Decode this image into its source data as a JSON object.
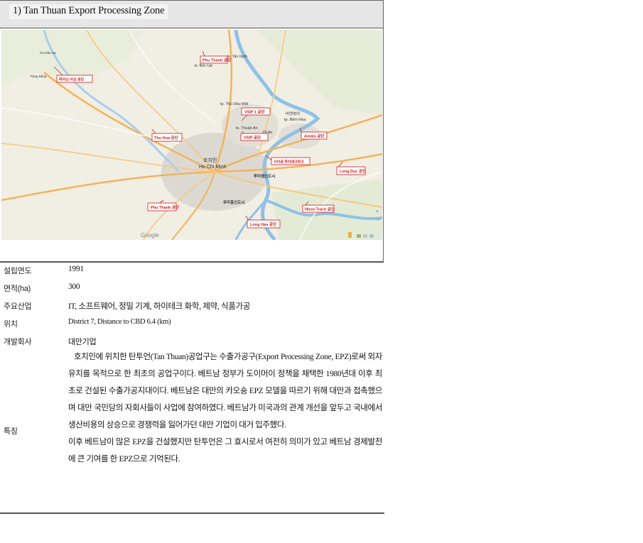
{
  "title": "1) Tan Thuan Export Processing Zone",
  "map": {
    "labels": {
      "phu_thanh": "Phu Thanh 공단",
      "tay_ninh": "떠이닌·이산 공단",
      "vsip_1": "VSIP 1 공단",
      "vsip_2": "VSIP 공단",
      "thu_hoa": "Thu Hoa 공단",
      "amata": "Amata 공단",
      "sai_gon": "사이공 하이테크파크",
      "long_duc": "Long Duc 공단",
      "phu_thanh_south": "Phu Thanh 공단",
      "nhon_trach": "Nhon Trach 공단",
      "long_hau": "Long Hau 공단"
    },
    "city_labels": {
      "hcm_kr": "호치민",
      "hcm": "Ho Chi Minh",
      "new_city_1": "투티엠신도시",
      "new_city_2": "푸미흥신도시",
      "thu_dau_mot": "tp. Thủ Dầu Một",
      "bien_hoa_kr": "비엔호아",
      "bien_hoa": "tp. Biên Hòa",
      "thuan_an": "tx. Thuận An",
      "di_an": "Dĩ An",
      "tan_uyen": "tx. Tân Uyên",
      "ben_cat": "tx. Bến Cát",
      "go_dau": "Gò Dầu Hạ",
      "trang_bang": "Trảng Bàng",
      "google": "Google"
    }
  },
  "info": {
    "founded_label": "설립연도",
    "founded": "1991",
    "area_label": "면적(ha)",
    "area": "300",
    "industry_label": "주요산업",
    "industry": "IT, 소프트웨어, 정밀 기계, 하이테크 화학, 제약, 식품가공",
    "location_label": "위치",
    "location": "District 7, Distance to CBD 6.4 (km)",
    "developer_label": "개발회사",
    "developer": "대만기업",
    "features_label": "특징",
    "features_p1": "호치민에 위치한 탄투언(Tan Thuan)공업구는 수출가공구(Export Processing Zone, EPZ)로써 외자유치를 목적으로 한 최초의 공업구이다. 베트남 정부가 도이머이 정책을 채택한 1980년대 이후 최초로 건설된 수출가공지대이다. 베트남은 대만의 카오숑 EPZ 모델을 따르기 위해 대만과 접촉했으며 대만 국민당의 자회사들이 사업에 참여하였다. 베트남가 미국과의 관계 개선을 앞두고 국내에서 생산비용의 상승으로 경쟁력을 잃어가던 대만 기업이 대거 입주했다.",
    "features_p2": "이후 베트남이 많은 EPZ을 건설했지만 탄투언은 그 효시로서 여전히 의미가 있고 베트남 경제발전에 큰 기여를 한 EPZ으로 기억된다."
  }
}
